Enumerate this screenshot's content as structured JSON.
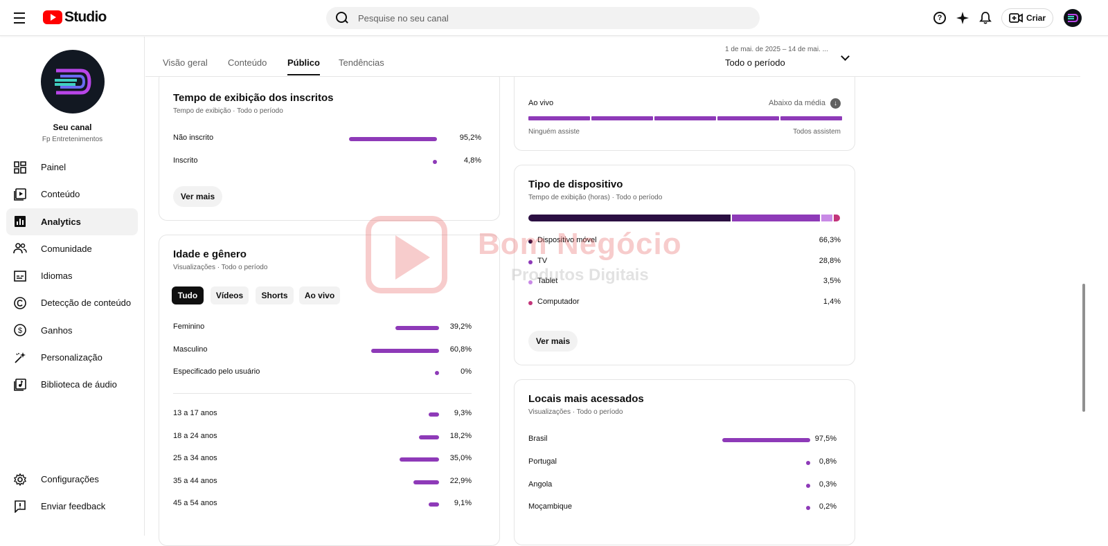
{
  "header": {
    "logo_text": "Studio",
    "search_placeholder": "Pesquise no seu canal",
    "create_label": "Criar"
  },
  "sidebar": {
    "channel_name": "Seu canal",
    "channel_subtitle": "Fp Entretenimentos",
    "items": [
      {
        "label": "Painel",
        "icon": "dashboard-icon"
      },
      {
        "label": "Conteúdo",
        "icon": "content-icon"
      },
      {
        "label": "Analytics",
        "icon": "analytics-icon",
        "active": true
      },
      {
        "label": "Comunidade",
        "icon": "community-icon"
      },
      {
        "label": "Idiomas",
        "icon": "subtitles-icon"
      },
      {
        "label": "Detecção de conteúdo",
        "icon": "copyright-icon"
      },
      {
        "label": "Ganhos",
        "icon": "earn-icon"
      },
      {
        "label": "Personalização",
        "icon": "magic-wand-icon"
      },
      {
        "label": "Biblioteca de áudio",
        "icon": "audio-library-icon"
      }
    ],
    "bottom_items": [
      {
        "label": "Configurações",
        "icon": "settings-icon"
      },
      {
        "label": "Enviar feedback",
        "icon": "feedback-icon"
      }
    ]
  },
  "tabs": [
    "Visão geral",
    "Conteúdo",
    "Público",
    "Tendências"
  ],
  "active_tab": "Público",
  "period": {
    "range": "1 de mai. de 2025 – 14 de mai. ...",
    "label": "Todo o período"
  },
  "subscriber_watch": {
    "title": "Tempo de exibição dos inscritos",
    "subtitle": "Tempo de exibição · Todo o período",
    "rows": [
      {
        "label": "Não inscrito",
        "value": "95,2%",
        "pct": 95.2
      },
      {
        "label": "Inscrito",
        "value": "4,8%",
        "pct": 4.8
      }
    ],
    "more_label": "Ver mais"
  },
  "age_gender": {
    "title": "Idade e gênero",
    "subtitle": "Visualizações · Todo o período",
    "chips": [
      "Tudo",
      "Vídeos",
      "Shorts",
      "Ao vivo"
    ],
    "gender_rows": [
      {
        "label": "Feminino",
        "value": "39,2%",
        "pct": 39.2
      },
      {
        "label": "Masculino",
        "value": "60,8%",
        "pct": 60.8
      },
      {
        "label": "Especificado pelo usuário",
        "value": "0%",
        "pct": 0
      }
    ],
    "age_rows": [
      {
        "label": "13 a 17 anos",
        "value": "9,3%",
        "pct": 9.3
      },
      {
        "label": "18 a 24 anos",
        "value": "18,2%",
        "pct": 18.2
      },
      {
        "label": "25 a 34 anos",
        "value": "35,0%",
        "pct": 35.0
      },
      {
        "label": "35 a 44 anos",
        "value": "22,9%",
        "pct": 22.9
      },
      {
        "label": "45 a 54 anos",
        "value": "9,1%",
        "pct": 9.1
      }
    ]
  },
  "live": {
    "label": "Ao vivo",
    "status": "Abaixo da média",
    "left_caption": "Ninguém assiste",
    "right_caption": "Todos assistem"
  },
  "device": {
    "title": "Tipo de dispositivo",
    "subtitle": "Tempo de exibição (horas) · Todo o período",
    "rows": [
      {
        "label": "Dispositivo móvel",
        "value": "66,3%",
        "pct": 66.3,
        "color": "#2b0f42"
      },
      {
        "label": "TV",
        "value": "28,8%",
        "pct": 28.8,
        "color": "#8e3ab8"
      },
      {
        "label": "Tablet",
        "value": "3,5%",
        "pct": 3.5,
        "color": "#c98ae6"
      },
      {
        "label": "Computador",
        "value": "1,4%",
        "pct": 1.4,
        "color": "#c2357a"
      }
    ],
    "more_label": "Ver mais"
  },
  "locations": {
    "title": "Locais mais acessados",
    "subtitle": "Visualizações · Todo o período",
    "rows": [
      {
        "label": "Brasil",
        "value": "97,5%",
        "pct": 97.5
      },
      {
        "label": "Portugal",
        "value": "0,8%",
        "pct": 0.8
      },
      {
        "label": "Angola",
        "value": "0,3%",
        "pct": 0.3
      },
      {
        "label": "Moçambique",
        "value": "0,2%",
        "pct": 0.2
      }
    ]
  },
  "watermark": {
    "title": "Bom Negócio",
    "subtitle": "Produtos Digitais"
  },
  "colors": {
    "accent": "#8e3ab8",
    "brand_red": "#ff0000"
  }
}
